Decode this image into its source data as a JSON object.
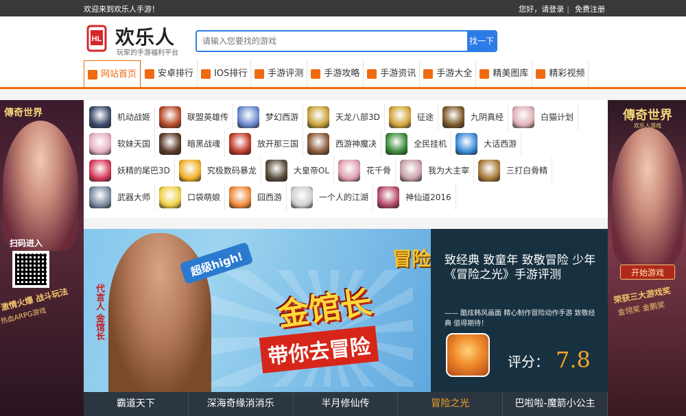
{
  "topbar": {
    "welcome": "欢迎来到欢乐人手游！",
    "greeting": "您好，请登录",
    "sep": "|",
    "register": "免费注册"
  },
  "header": {
    "logo_title": "欢乐人",
    "logo_subtitle": "玩家的手游福利平台",
    "search_placeholder": "请输入您要找的游戏",
    "search_button": "找一下"
  },
  "nav": [
    {
      "label": "网站首页",
      "icon": "home-icon",
      "color": "#f06a0f"
    },
    {
      "label": "安卓排行",
      "icon": "android-icon",
      "color": "#f06a0f"
    },
    {
      "label": "IOS排行",
      "icon": "apple-icon",
      "color": "#f06a0f"
    },
    {
      "label": "手游评测",
      "icon": "gift-icon",
      "color": "#f06a0f"
    },
    {
      "label": "手游攻略",
      "icon": "document-icon",
      "color": "#f06a0f"
    },
    {
      "label": "手游资讯",
      "icon": "book-icon",
      "color": "#f06a0f"
    },
    {
      "label": "手游大全",
      "icon": "search-icon",
      "color": "#f06a0f"
    },
    {
      "label": "精美图库",
      "icon": "album-icon",
      "color": "#f06a0f"
    },
    {
      "label": "精彩视频",
      "icon": "video-icon",
      "color": "#f06a0f"
    }
  ],
  "games": [
    {
      "name": "机动战姬",
      "color": "#3a4a6a"
    },
    {
      "name": "联盟英雄传",
      "color": "#b84a2a"
    },
    {
      "name": "梦幻西游",
      "color": "#6a8ad0"
    },
    {
      "name": "天龙八部3D",
      "color": "#c8a23a"
    },
    {
      "name": "征途",
      "color": "#d2a43a"
    },
    {
      "name": "九阴真经",
      "color": "#7a5a2a"
    },
    {
      "name": "白猫计划",
      "color": "#e0b0b8"
    },
    {
      "name": "软妹天国",
      "color": "#e6b0c4"
    },
    {
      "name": "暗黑战魂",
      "color": "#5a3a2a"
    },
    {
      "name": "放开那三国",
      "color": "#c03a2a"
    },
    {
      "name": "西游神魔决",
      "color": "#8a5a3a"
    },
    {
      "name": "全民挂机",
      "color": "#3a8a3a"
    },
    {
      "name": "大话西游",
      "color": "#3a8ad8"
    },
    {
      "name": "妖精的尾巴3D",
      "color": "#d83a5a"
    },
    {
      "name": "究极数码暴龙",
      "color": "#f0b02a"
    },
    {
      "name": "大皇帝OL",
      "color": "#5a4a3a"
    },
    {
      "name": "花千骨",
      "color": "#e0a0b0"
    },
    {
      "name": "我为大主宰",
      "color": "#c8a0a8"
    },
    {
      "name": "三打白骨精",
      "color": "#a87a3a"
    },
    {
      "name": "武器大师",
      "color": "#7a8aa0"
    },
    {
      "name": "口袋萌娘",
      "color": "#f0d04a"
    },
    {
      "name": "囧西游",
      "color": "#f08a3a"
    },
    {
      "name": "一个人的江湖",
      "color": "#cfcfcf"
    },
    {
      "name": "神仙道2016",
      "color": "#b84a6a"
    }
  ],
  "left_banner": {
    "title": "傳奇世界",
    "scan_label": "扫码进入",
    "slogan": "激情火爆 战斗玩法",
    "slogan2": "热血ARPG游戏"
  },
  "right_banner": {
    "title": "傳奇世界",
    "subtitle": "欢乐人游戏",
    "start_button": "开始游戏",
    "slogan": "荣获三大游戏奖",
    "slogan2": "金翎奖 金鹏奖"
  },
  "hero": {
    "spokesman": "代言人 金馆长",
    "bubble": "超级high!",
    "big_text1": "金馆长",
    "big_text2": "带你去冒险",
    "game_logo": "冒险",
    "headline": "致经典 致童年 致敬冒险 少年 《冒险之光》手游评测",
    "desc": "—— 酷炫韩风画面 精心制作冒险动作手游 致敬经典 值得期待！",
    "score_label": "评分：",
    "score": "7.8"
  },
  "tabs": [
    {
      "label": "霸道天下",
      "active": false
    },
    {
      "label": "深海奇缘消消乐",
      "active": false
    },
    {
      "label": "半月修仙传",
      "active": false
    },
    {
      "label": "冒险之光",
      "active": true
    },
    {
      "label": "巴啦啦-魔箭小公主",
      "active": false
    }
  ]
}
